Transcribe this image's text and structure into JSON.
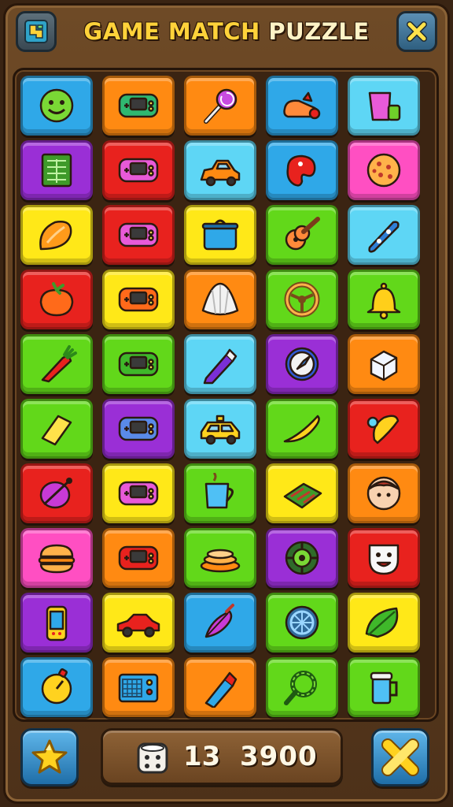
{
  "header": {
    "title_part1": "GAME MATCH",
    "title_part2": "PUZZLE",
    "menu_icon": "map-icon",
    "close_icon": "close-icon"
  },
  "colors": {
    "blue": "#2fa8e8",
    "orange": "#ff8a12",
    "cyan": "#5ed6f5",
    "purple": "#9a2fd6",
    "red": "#e8221e",
    "pink": "#ff4fc2",
    "yellow": "#ffe818",
    "green": "#62d81a"
  },
  "board": {
    "rows": [
      [
        {
          "color": "blue",
          "icon": "smiley-ball-icon"
        },
        {
          "color": "orange",
          "icon": "game-console-icon"
        },
        {
          "color": "orange",
          "icon": "lollipop-icon"
        },
        {
          "color": "blue",
          "icon": "sneaker-icon"
        },
        {
          "color": "cyan",
          "icon": "cup-icon"
        }
      ],
      [
        {
          "color": "purple",
          "icon": "chocolate-bar-icon"
        },
        {
          "color": "red",
          "icon": "game-console-icon"
        },
        {
          "color": "cyan",
          "icon": "toy-car-icon"
        },
        {
          "color": "blue",
          "icon": "palette-icon"
        },
        {
          "color": "pink",
          "icon": "cookie-icon"
        }
      ],
      [
        {
          "color": "yellow",
          "icon": "mango-icon"
        },
        {
          "color": "red",
          "icon": "game-console-icon"
        },
        {
          "color": "yellow",
          "icon": "cooking-pot-icon"
        },
        {
          "color": "green",
          "icon": "guitar-icon"
        },
        {
          "color": "cyan",
          "icon": "snowboard-icon"
        }
      ],
      [
        {
          "color": "red",
          "icon": "tomato-icon"
        },
        {
          "color": "yellow",
          "icon": "game-console-icon"
        },
        {
          "color": "orange",
          "icon": "shell-icon"
        },
        {
          "color": "green",
          "icon": "steering-wheel-icon"
        },
        {
          "color": "green",
          "icon": "bell-icon"
        }
      ],
      [
        {
          "color": "green",
          "icon": "carrot-icon"
        },
        {
          "color": "green",
          "icon": "game-console-icon"
        },
        {
          "color": "cyan",
          "icon": "crayon-icon"
        },
        {
          "color": "purple",
          "icon": "compass-icon"
        },
        {
          "color": "orange",
          "icon": "sugar-cube-icon"
        }
      ],
      [
        {
          "color": "green",
          "icon": "cheese-icon"
        },
        {
          "color": "purple",
          "icon": "game-console-icon"
        },
        {
          "color": "cyan",
          "icon": "taxi-icon"
        },
        {
          "color": "green",
          "icon": "banana-icon"
        },
        {
          "color": "red",
          "icon": "pacifier-icon"
        }
      ],
      [
        {
          "color": "red",
          "icon": "beetle-icon"
        },
        {
          "color": "yellow",
          "icon": "game-console-icon"
        },
        {
          "color": "green",
          "icon": "mug-icon"
        },
        {
          "color": "yellow",
          "icon": "cake-icon"
        },
        {
          "color": "orange",
          "icon": "face-icon"
        }
      ],
      [
        {
          "color": "pink",
          "icon": "burger-icon"
        },
        {
          "color": "orange",
          "icon": "game-console-icon"
        },
        {
          "color": "green",
          "icon": "pancakes-icon"
        },
        {
          "color": "purple",
          "icon": "tire-icon"
        },
        {
          "color": "red",
          "icon": "mask-icon"
        }
      ],
      [
        {
          "color": "purple",
          "icon": "phone-icon"
        },
        {
          "color": "yellow",
          "icon": "red-car-icon"
        },
        {
          "color": "blue",
          "icon": "feather-pen-icon"
        },
        {
          "color": "green",
          "icon": "wheel-icon"
        },
        {
          "color": "yellow",
          "icon": "leaf-icon"
        }
      ],
      [
        {
          "color": "blue",
          "icon": "stopwatch-icon"
        },
        {
          "color": "orange",
          "icon": "radio-icon"
        },
        {
          "color": "orange",
          "icon": "marker-icon"
        },
        {
          "color": "green",
          "icon": "gear-magnifier-icon"
        },
        {
          "color": "green",
          "icon": "beer-mug-icon"
        }
      ]
    ]
  },
  "footer": {
    "left_icon": "star-icon",
    "right_icon": "cross-bandage-icon",
    "moves": "13",
    "score": "3900",
    "dice_icon": "dice-icon"
  }
}
